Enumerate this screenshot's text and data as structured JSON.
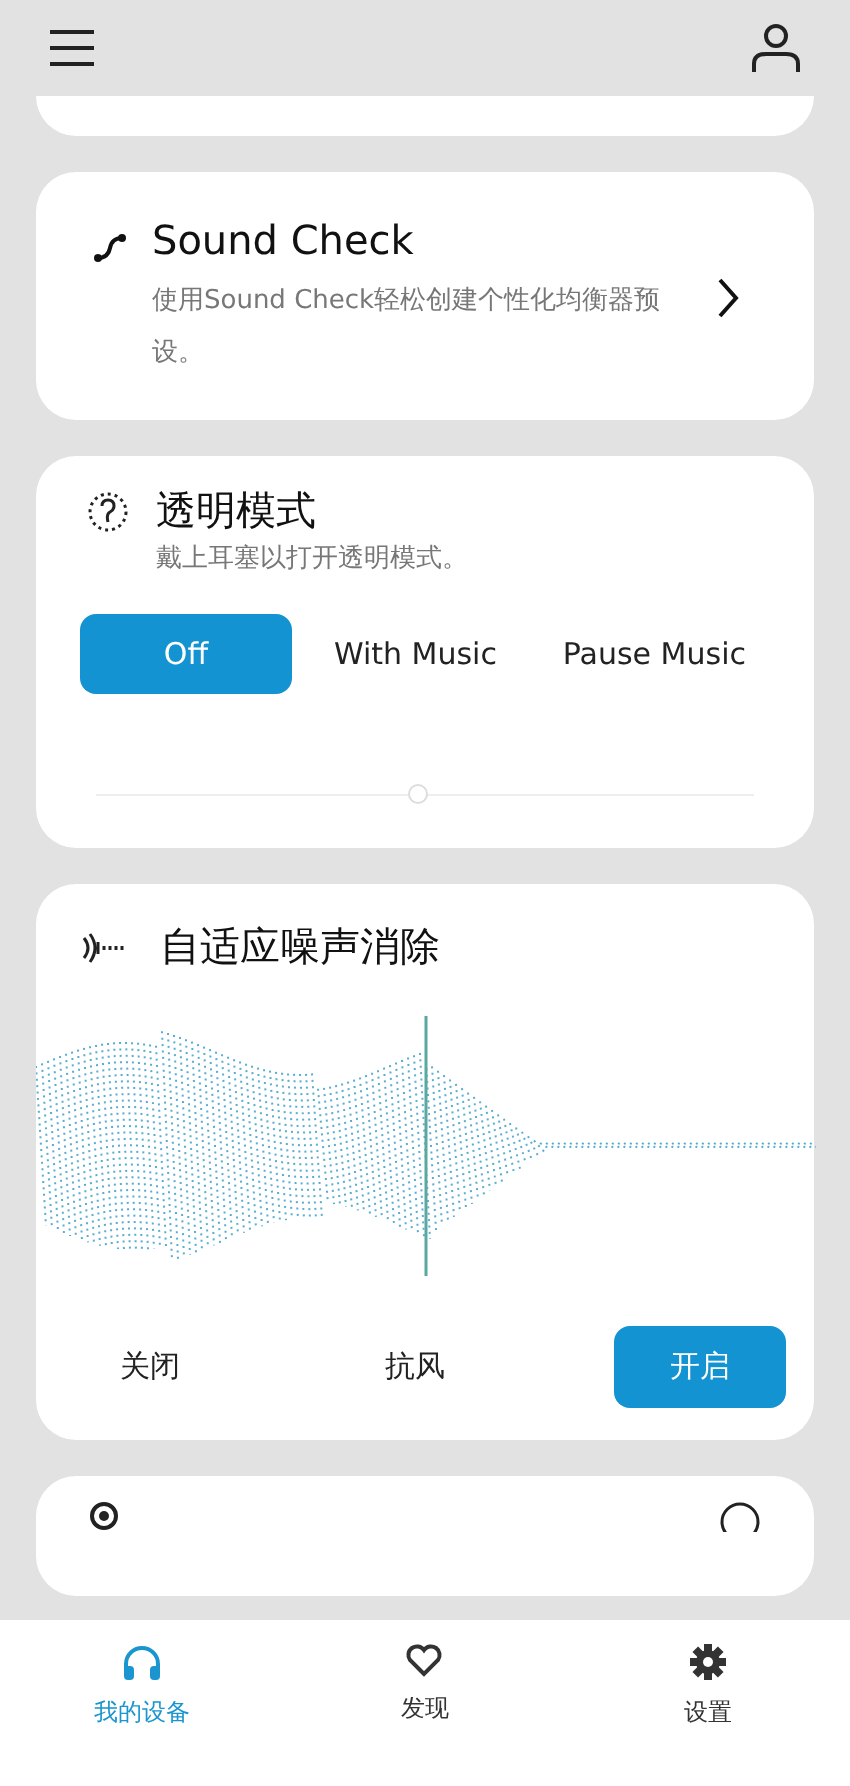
{
  "sound_check": {
    "title": "Sound Check",
    "description": "使用Sound Check轻松创建个性化均衡器预设。"
  },
  "transparency": {
    "title": "透明模式",
    "description": "戴上耳塞以打开透明模式。",
    "options": [
      {
        "label": "Off",
        "selected": true
      },
      {
        "label": "With Music",
        "selected": false
      },
      {
        "label": "Pause Music",
        "selected": false
      }
    ],
    "slider": {
      "level": 0.49
    }
  },
  "anc": {
    "title": "自适应噪声消除",
    "options": [
      {
        "label": "关闭",
        "selected": false
      },
      {
        "label": "抗风",
        "selected": false
      },
      {
        "label": "开启",
        "selected": true
      }
    ]
  },
  "bottom_nav": [
    {
      "label": "我的设备",
      "selected": true
    },
    {
      "label": "发现",
      "selected": false
    },
    {
      "label": "设置",
      "selected": false
    }
  ]
}
